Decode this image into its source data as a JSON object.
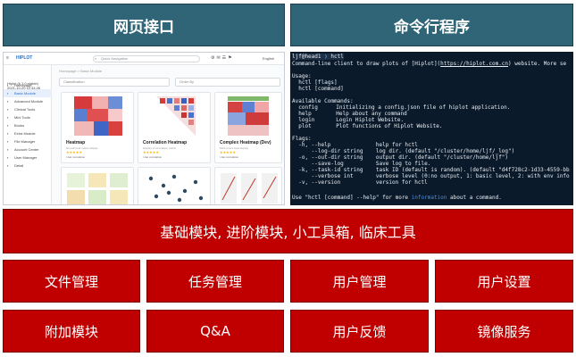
{
  "headers": {
    "web": "网页接口",
    "cli": "命令行程序"
  },
  "banner": "基础模块, 进阶模块, 小工具箱, 临床工具",
  "boxes_row1": [
    "文件管理",
    "任务管理",
    "用户管理",
    "用户设置"
  ],
  "boxes_row2": [
    "附加模块",
    "Q&A",
    "用户反馈",
    "镜像服务"
  ],
  "web_ui": {
    "logo": "HIPLOT",
    "search_placeholder": "Quick Navigation",
    "language": "English",
    "user_lines": [
      "Hiplot (6.1.0-stable)",
      "2021-10-20 12:34:26"
    ],
    "nav": [
      "Homepage",
      "Basic Module",
      "Advanced Module",
      "Clinical Tools",
      "Mini Tools",
      "Books",
      "Extra Module",
      "File Manager",
      "Account Center",
      "User Manager",
      "Detail"
    ],
    "active_nav": "Basic Module",
    "breadcrumb": "Homepage  >  Basic Module",
    "filter_classification": "Classification",
    "filter_order": "Order By",
    "cards": [
      {
        "title": "Heatmap",
        "desc": "Normal heat matrix display",
        "stars": "★★★★★",
        "tags": "r-bar  correlation"
      },
      {
        "title": "Correlation Heatmap",
        "desc": "Display of correlation matrix",
        "stars": "★★★★★",
        "tags": "r-bar  correlation"
      },
      {
        "title": "Complex Heatmap (Dev)",
        "desc": "Multi-omics heat display",
        "stars": "★★★★★",
        "tags": "r-bar  correlation"
      }
    ]
  },
  "terminal": {
    "prompt_user": "ljf@head1",
    "prompt_cmd": "hctl",
    "intro_a": "Command-line client to draw plots of [Hiplot](",
    "intro_url": "https://hiplot.com.cn",
    "intro_b": ") website. More se",
    "usage_title": "Usage:",
    "usage_lines": [
      "  hctl [flags]",
      "  hctl [command]"
    ],
    "commands_title": "Available Commands:",
    "commands": [
      {
        "name": "config",
        "desc": "Initializing a config.json file of hiplot application."
      },
      {
        "name": "help",
        "desc": "Help about any command"
      },
      {
        "name": "login",
        "desc": "Login Hiplot Website."
      },
      {
        "name": "plot",
        "desc": "Plot functions of Hiplot Website."
      }
    ],
    "flags_title": "Flags:",
    "flags": [
      "  -h, --help              help for hctl",
      "      --log-dir string    log dir. (default \"/cluster/home/ljf/_log\")",
      "  -o, --out-dir string    output dir. (default \"/cluster/home/ljf\")",
      "      --save-log          Save log to file.",
      "  -k, --task-id string    task ID (default is random). (default \"d4f728c2-1d33-4559-bb",
      "      --verbose int       verbose level (0:no output, 1: basic level, 2: with env info",
      "  -v, --version           version for hctl"
    ],
    "footer_a": "Use \"hctl [command] --help\" for more ",
    "footer_info": "information",
    "footer_b": " about a command."
  },
  "colors": {
    "header_bg": "#2f6577",
    "module_bg": "#c00000",
    "terminal_bg": "#0b1a2a"
  }
}
